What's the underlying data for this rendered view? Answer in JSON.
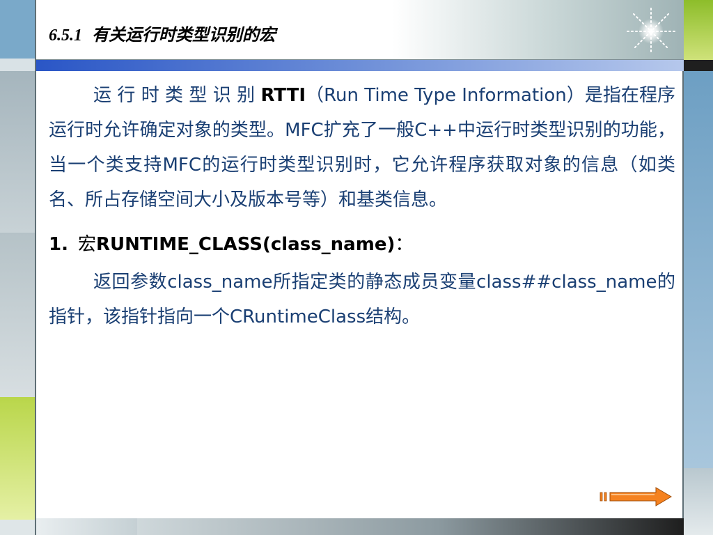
{
  "slide": {
    "section_number": "6.5.1",
    "title": "有关运行时类型识别的宏"
  },
  "body": {
    "paragraph1": {
      "lead": "运 行 时 类 型 识 别 ",
      "term": "RTTI",
      "rest": "（Run Time Type Information）是指在程序运行时允许确定对象的类型。MFC扩充了一般C++中运行时类型识别的功能，当一个类支持MFC的运行时类型识别时，它允许程序获取对象的信息（如类名、所占存储空间大小及版本号等）和基类信息。"
    },
    "heading1": {
      "number": "1.",
      "label": "宏",
      "macro": "RUNTIME_CLASS(class_name)",
      "colon": "："
    },
    "paragraph2": "返回参数class_name所指定类的静态成员变量class##class_name的指针，该指针指向一个CRuntimeClass结构。"
  },
  "colors": {
    "body_text": "#1a3f73",
    "blue_bar": "#2a56c6",
    "arrow": "#f58220",
    "green_accent": "#8dbd2a"
  },
  "icons": {
    "sparkle": "sparkle-icon",
    "next": "next-arrow-icon"
  }
}
